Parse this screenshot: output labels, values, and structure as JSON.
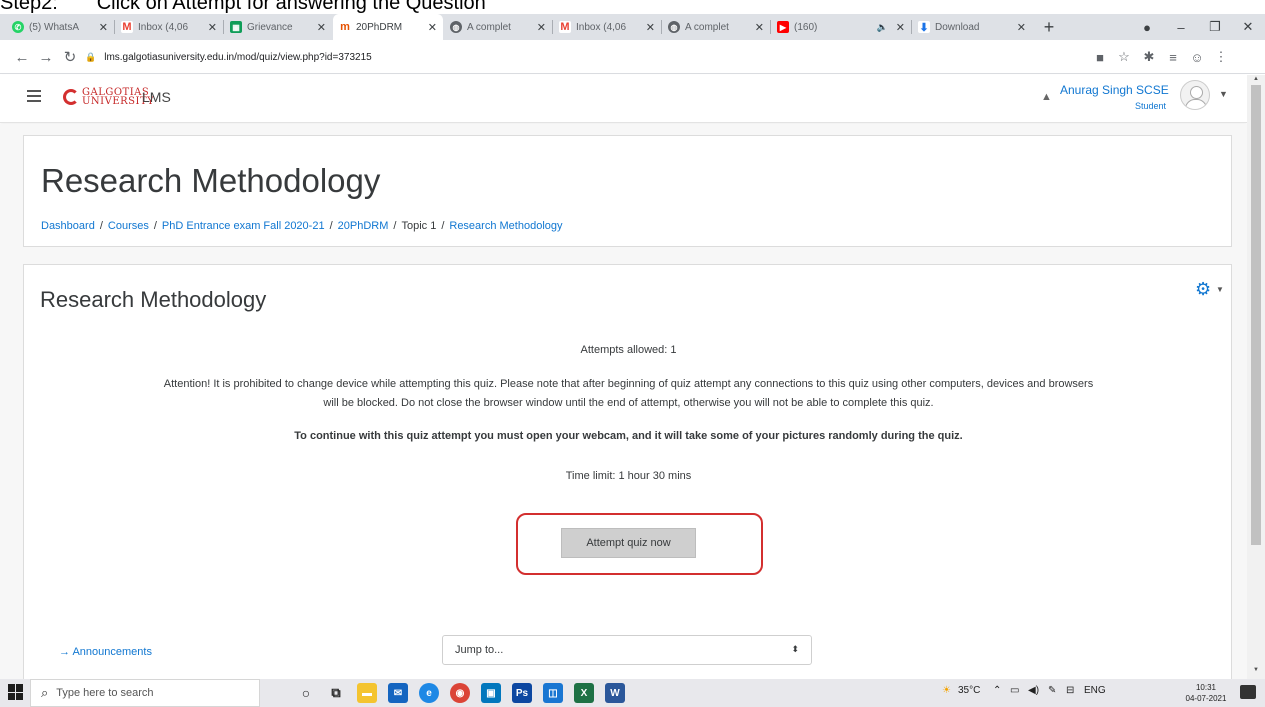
{
  "caption": "Step2:       Click on Attempt for answering the Question",
  "browser": {
    "tabs": [
      {
        "title": "(5) WhatsA",
        "color": "#25d366",
        "icon": "whatsapp-icon"
      },
      {
        "title": "Inbox (4,06",
        "color": "#ea4335",
        "icon": "gmail-icon"
      },
      {
        "title": "Grievance",
        "color": "#0f9d58",
        "icon": "sheets-icon"
      },
      {
        "title": "20PhDRM",
        "color": "#e65100",
        "icon": "moodle-icon"
      },
      {
        "title": "A complet",
        "color": "#5f6368",
        "icon": "globe-icon"
      },
      {
        "title": "Inbox (4,06",
        "color": "#ea4335",
        "icon": "gmail-icon"
      },
      {
        "title": "A complet",
        "color": "#5f6368",
        "icon": "globe-icon"
      },
      {
        "title": "(160)",
        "color": "#ff0000",
        "icon": "youtube-icon"
      },
      {
        "title": "Download",
        "color": "#1a73e8",
        "icon": "download-icon"
      }
    ],
    "url": "lms.galgotiasuniversity.edu.in/mod/quiz/view.php?id=373215"
  },
  "navbar": {
    "brand_line1": "GALGOTIAS",
    "brand_line2": "UNIVERSITY",
    "lms_label": "LMS",
    "user_name": "Anurag Singh SCSE",
    "user_role": "Student"
  },
  "header": {
    "title": "Research Methodology",
    "breadcrumb": [
      "Dashboard",
      "Courses",
      "PhD Entrance exam Fall 2020-21",
      "20PhDRM",
      "Topic 1",
      "Research Methodology"
    ]
  },
  "quiz": {
    "title": "Research Methodology",
    "attempts": "Attempts allowed: 1",
    "attention_line1": "Attention! It is prohibited to change device while attempting this quiz. Please note that after beginning of quiz attempt any connections to this quiz using other computers, devices and browsers",
    "attention_line2": "will be blocked. Do not close the browser window until the end of attempt, otherwise you will not be able to complete this quiz.",
    "webcam_note": "To continue with this quiz attempt you must open your webcam, and it will take some of your pictures randomly during the quiz.",
    "time_limit": "Time limit: 1 hour 30 mins",
    "attempt_button": "Attempt quiz now"
  },
  "footer_nav": {
    "prev_link": "Announcements",
    "jump_label": "Jump to..."
  },
  "taskbar": {
    "search_placeholder": "Type here to search",
    "weather": "35°C",
    "lang": "ENG",
    "time": "10:31",
    "date": "04-07-2021"
  }
}
